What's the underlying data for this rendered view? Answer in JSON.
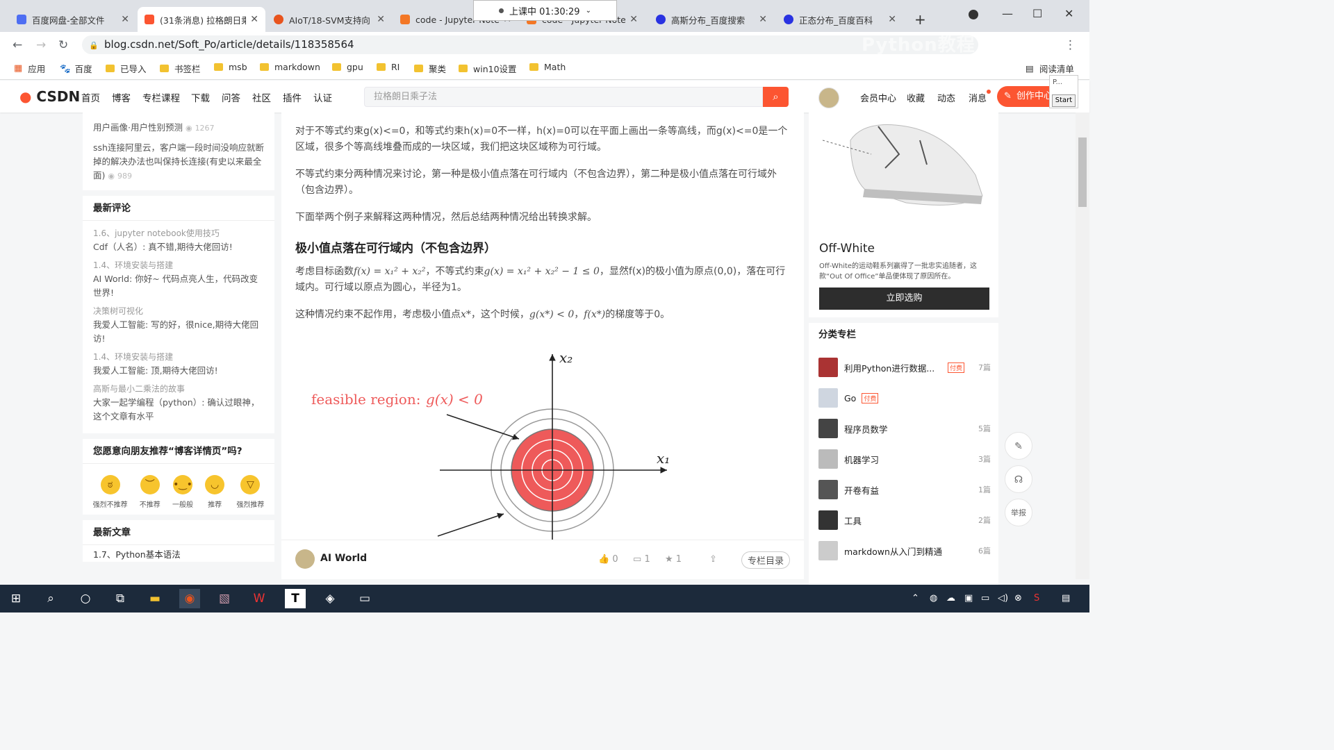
{
  "browser": {
    "tabs": [
      {
        "title": "百度网盘-全部文件",
        "favicon_color": "#4e6ef2"
      },
      {
        "title": "(31条消息) 拉格朗日乘",
        "favicon_color": "#fc5531"
      },
      {
        "title": "AIoT/18-SVM支持向",
        "favicon_color": "#e8541e"
      },
      {
        "title": "code - Jupyter Note",
        "favicon_color": "#f37726"
      },
      {
        "title": "code - Jupyter Note",
        "favicon_color": "#f37726"
      },
      {
        "title": "高斯分布_百度搜索",
        "favicon_color": "#2932e1"
      },
      {
        "title": "正态分布_百度百科",
        "favicon_color": "#2932e1"
      }
    ],
    "recording": "上课中 01:30:29",
    "url": "blog.csdn.net/Soft_Po/article/details/118358564",
    "watermark": "Python教程",
    "bookmarks": [
      "应用",
      "百度",
      "已导入",
      "书签栏",
      "msb",
      "markdown",
      "gpu",
      "RI",
      "聚类",
      "win10设置",
      "Math"
    ],
    "reading_list": "阅读清单",
    "popup_label": "P...",
    "start_label": "Start"
  },
  "csdn": {
    "logo": "CSDN",
    "nav": [
      "首页",
      "博客",
      "专栏课程",
      "下载",
      "问答",
      "社区",
      "插件",
      "认证"
    ],
    "search_placeholder": "拉格朗日乘子法",
    "user_links": [
      "会员中心",
      "收藏",
      "动态",
      "消息"
    ],
    "create_label": "创作中心",
    "accent": "#fc5531"
  },
  "left": {
    "top_items": [
      {
        "text": "用户画像·用户性别预测",
        "views": "1267"
      },
      {
        "text": "ssh连接阿里云，客户端一段时间没响应就断掉的解决办法也叫保持长连接(有史以来最全面)",
        "views": "989"
      }
    ],
    "comments_title": "最新评论",
    "comments": [
      {
        "article": "1.6、jupyter notebook使用技巧",
        "text": "Cdf（人名）: 真不错,期待大佬回访!"
      },
      {
        "article": "1.4、环境安装与搭建",
        "text": "AI World: 你好~ 代码点亮人生，代码改变世界!"
      },
      {
        "article": "决策树可视化",
        "text": "我爱人工智能: 写的好，很nice,期待大佬回访!"
      },
      {
        "article": "1.4、环境安装与搭建",
        "text": "我爱人工智能: 顶,期待大佬回访!"
      },
      {
        "article": "高斯与最小二乘法的故事",
        "text": "大家一起学编程（python）: 确认过眼神，这个文章有水平"
      }
    ],
    "recommend_title": "您愿意向朋友推荐“博客详情页”吗?",
    "faces": [
      "强烈不推荐",
      "不推荐",
      "一般般",
      "推荐",
      "强烈推荐"
    ],
    "latest_title": "最新文章",
    "latest_first": "1.7、Python基本语法"
  },
  "article": {
    "p1": "对于不等式约束g(x)<=0，和等式约束h(x)=0不一样，h(x)=0可以在平面上画出一条等高线，而g(x)<=0是一个区域，很多个等高线堆叠而成的一块区域，我们把这块区域称为可行域。",
    "p2": "不等式约束分两种情况来讨论，第一种是极小值点落在可行域内（不包含边界），第二种是极小值点落在可行域外（包含边界）。",
    "p3": "下面举两个例子来解释这两种情况，然后总结两种情况给出转换求解。",
    "h3": "极小值点落在可行域内（不包含边界）",
    "p4_a": "考虑目标函数",
    "p4_m1": "f(x) = x₁² + x₂²",
    "p4_b": "，不等式约束",
    "p4_m2": "g(x) = x₁² + x₂² − 1 ≤ 0",
    "p4_c": "，显然f(x)的极小值为原点(0,0)，落在可行域内。可行域以原点为圆心，半径为1。",
    "p5_a": "这种情况约束不起作用，考虑极小值点",
    "p5_m1": "x*",
    "p5_b": "，这个时候，",
    "p5_m2": "g(x*) < 0",
    "p5_c": "，",
    "p5_m3": "f(x*)",
    "p5_d": "的梯度等于0。",
    "figure": {
      "label": "feasible region:",
      "label_math": "g(x) < 0",
      "x1": "x₁",
      "x2": "x₂",
      "region_color": "#ee5a5a"
    },
    "author": "AI World",
    "likes": "0",
    "comments": "1",
    "stars": "1",
    "toc_label": "专栏目录"
  },
  "right": {
    "ad_title": "Off-White",
    "ad_desc": "Off-White的运动鞋系列赢得了一批忠实追随者，这款“Out Of Office”单品便体现了原因所在。",
    "ad_button": "立即选购",
    "cat_title": "分类专栏",
    "categories": [
      {
        "name": "利用Python进行数据...",
        "paid": "付费",
        "count": "7篇"
      },
      {
        "name": "Go",
        "paid": "付费",
        "count": ""
      },
      {
        "name": "程序员数学",
        "paid": "",
        "count": "5篇"
      },
      {
        "name": "机器学习",
        "paid": "",
        "count": "3篇"
      },
      {
        "name": "开卷有益",
        "paid": "",
        "count": "1篇"
      },
      {
        "name": "工具",
        "paid": "",
        "count": "2篇"
      },
      {
        "name": "markdown从入门到精通",
        "paid": "",
        "count": "6篇"
      }
    ],
    "report": "举报"
  }
}
